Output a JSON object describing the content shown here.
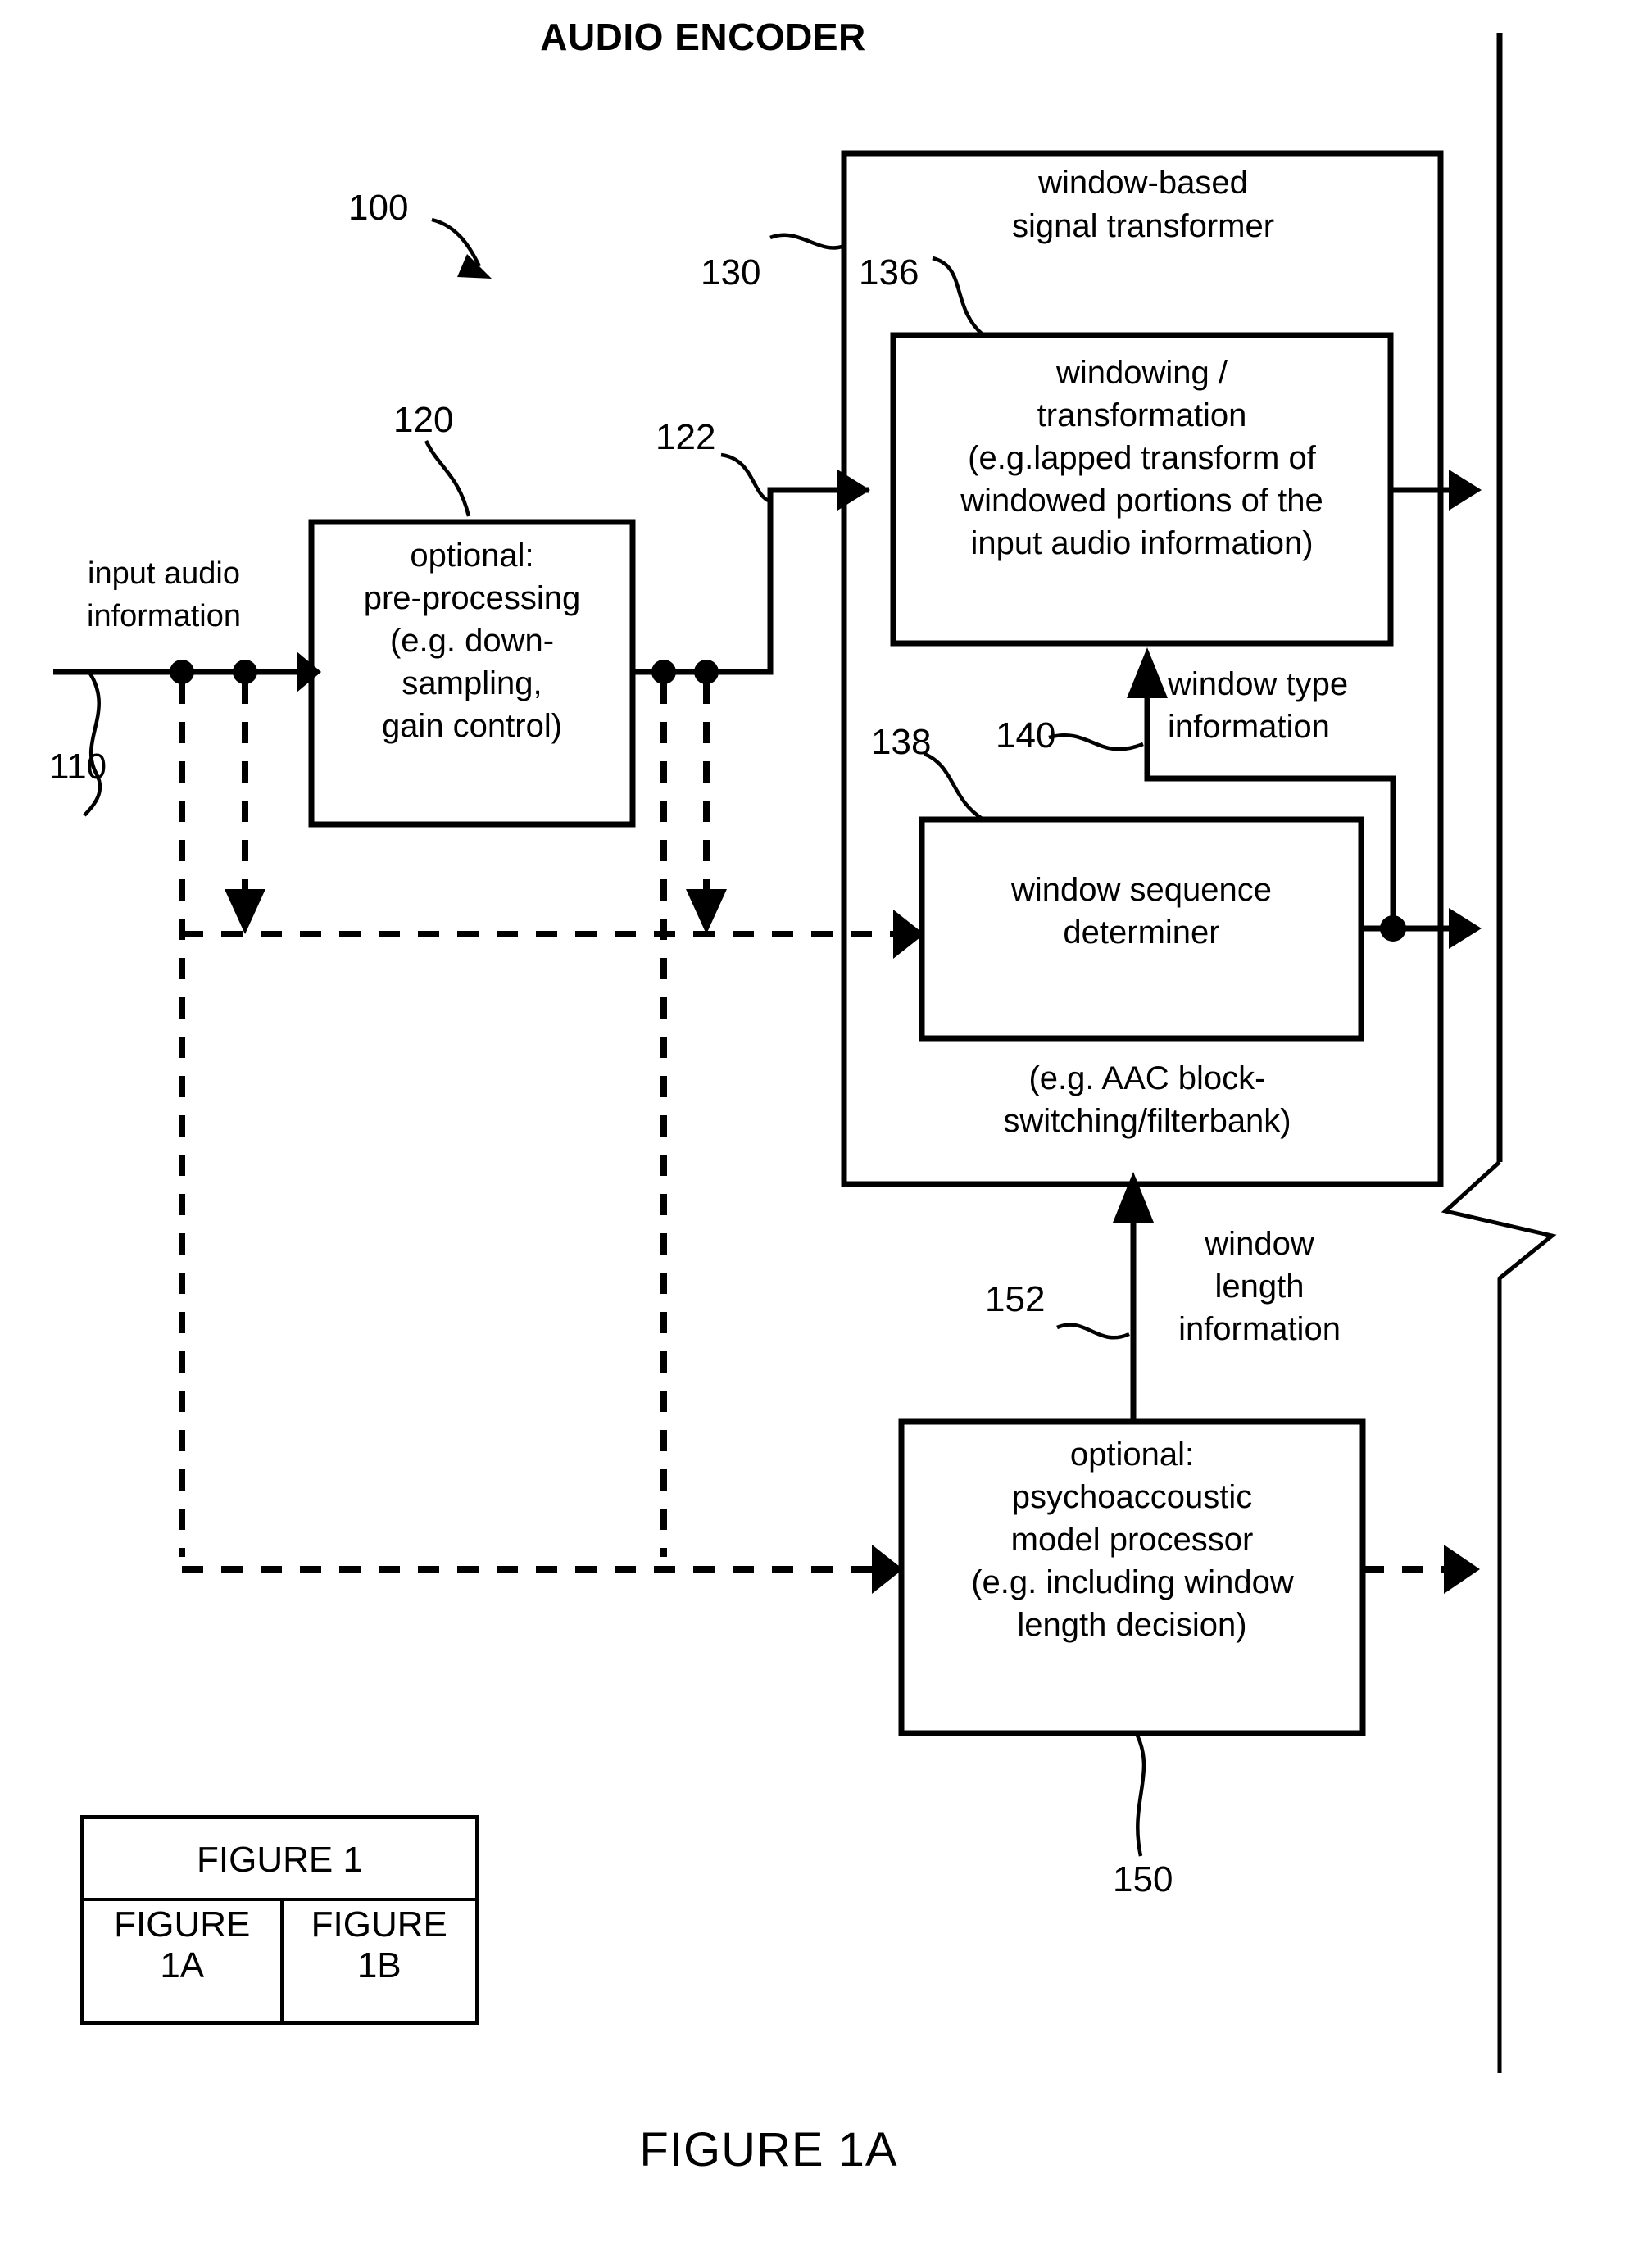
{
  "figure": {
    "title": "AUDIO ENCODER",
    "caption": "FIGURE 1A"
  },
  "blocks": {
    "signal_transformer": {
      "ref": "130",
      "label_line1": "window-based",
      "label_line2": "signal transformer",
      "note_line1": "(e.g. AAC block-",
      "note_line2": "switching/filterbank)"
    },
    "windowing": {
      "ref": "136",
      "line1": "windowing /",
      "line2": "transformation",
      "line3": "(e.g.lapped transform of",
      "line4": "windowed portions of the",
      "line5": "input audio information)"
    },
    "window_sequence_determiner": {
      "ref": "138",
      "line1": "window sequence",
      "line2": "determiner"
    },
    "preprocessing": {
      "ref": "120",
      "line1": "optional:",
      "line2": "pre-processing",
      "line3": "(e.g. down-",
      "line4": "sampling,",
      "line5": "gain control)"
    },
    "psychoacoustic": {
      "ref": "150",
      "line1": "optional:",
      "line2": "psychoaccoustic",
      "line3": "model processor",
      "line4": "(e.g. including window",
      "line5": "length decision)"
    }
  },
  "signals": {
    "input_audio": {
      "ref": "110",
      "line1": "input audio",
      "line2": "information"
    },
    "preprocessed": {
      "ref": "122"
    },
    "window_type": {
      "ref": "140",
      "line1": "window type",
      "line2": "information"
    },
    "window_length": {
      "ref": "152",
      "line1": "window",
      "line2": "length",
      "line3": "information"
    },
    "apparatus": {
      "ref": "100"
    }
  },
  "figure_index": {
    "header": "FIGURE 1",
    "left_line1": "FIGURE",
    "left_line2": "1A",
    "right_line1": "FIGURE",
    "right_line2": "1B"
  }
}
